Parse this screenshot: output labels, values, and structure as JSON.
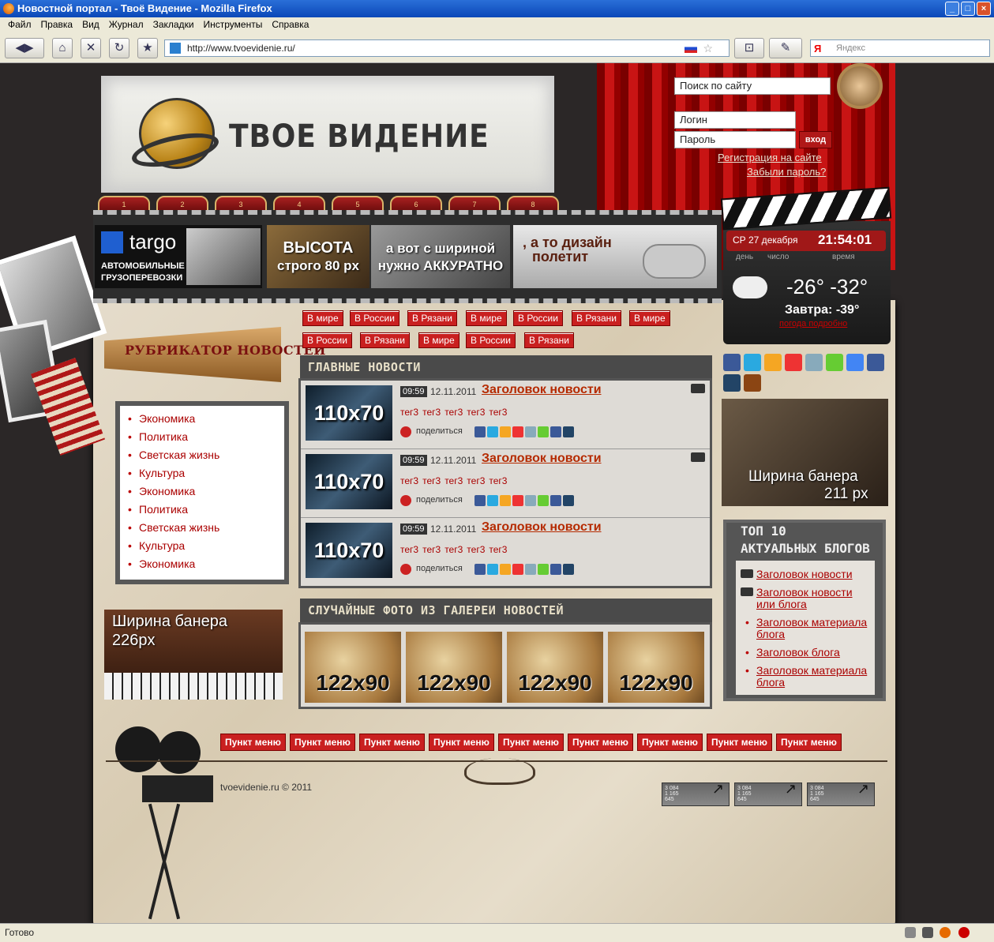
{
  "browser": {
    "title": "Новостной портал - Твоё Видение - Mozilla Firefox",
    "menu": [
      "Файл",
      "Правка",
      "Вид",
      "Журнал",
      "Закладки",
      "Инструменты",
      "Справка"
    ],
    "url": "http://www.tvoevidenie.ru/",
    "search_placeholder": "Яндекс",
    "search_engine_letter": "Я",
    "status": "Готово"
  },
  "header": {
    "logo_text": "ТВОЕ ВИДЕНИЕ",
    "site_search": "Поиск по сайту",
    "login": "Логин",
    "password": "Пароль",
    "login_button": "вход",
    "register": "Регистрация на сайте",
    "forgot": "Забыли пароль?",
    "tab_numbers": [
      "1",
      "2",
      "3",
      "4",
      "5",
      "6",
      "7",
      "8"
    ]
  },
  "banners": {
    "targo_name": "targo",
    "targo_sub1": "АВТОМОБИЛЬНЫЕ",
    "targo_sub2": "ГРУЗОПЕРЕВОЗКИ",
    "height_line1": "ВЫСОТА",
    "height_line2": "строго 80 px",
    "width_line1": "а вот с шириной",
    "width_line2": "нужно АККУРАТНО",
    "design_line1": ", а то дизайн",
    "design_line2": "полетит"
  },
  "rubricator": {
    "title": "РУБРИКАТОР НОВОСТЕЙ",
    "items": [
      "Экономика",
      "Политика",
      "Светская жизнь",
      "Культура",
      "Экономика",
      "Политика",
      "Светская жизнь",
      "Культура",
      "Экономика"
    ]
  },
  "left_banner": {
    "line1": "Ширина банера",
    "line2": "226px"
  },
  "categories_row1": [
    "В мире",
    "В России",
    "В Рязани",
    "В мире",
    "В России",
    "В Рязани",
    "В мире"
  ],
  "categories_row2": [
    "В России",
    "В Рязани",
    "В мире",
    "В России",
    "В Рязани"
  ],
  "main_news": {
    "title": "ГЛАВНЫЕ НОВОСТИ",
    "share_label": "поделиться",
    "items": [
      {
        "thumb": "110x70",
        "time": "09:59",
        "date": "12.11.2011",
        "headline": "Заголовок новости",
        "tags": [
          "тег3",
          "тег3",
          "тег3",
          "тег3",
          "тег3"
        ]
      },
      {
        "thumb": "110x70",
        "time": "09:59",
        "date": "12.11.2011",
        "headline": "Заголовок новости",
        "tags": [
          "тег3",
          "тег3",
          "тег3",
          "тег3",
          "тег3"
        ]
      },
      {
        "thumb": "110x70",
        "time": "09:59",
        "date": "12.11.2011",
        "headline": "Заголовок новости",
        "tags": [
          "тег3",
          "тег3",
          "тег3",
          "тег3",
          "тег3"
        ]
      }
    ]
  },
  "gallery": {
    "title": "СЛУЧАЙНЫЕ ФОТО ИЗ ГАЛЕРЕИ НОВОСТЕЙ",
    "items": [
      "122x90",
      "122x90",
      "122x90",
      "122x90"
    ]
  },
  "weather": {
    "date": "СР 27 декабря",
    "time": "21:54:01",
    "label_day": "день",
    "label_number": "число",
    "label_time": "время",
    "temp": "-26° -32°",
    "tomorrow": "Завтра: -39°",
    "more": "погода подробно"
  },
  "right_banner": {
    "line1": "Ширина банера",
    "line2": "211 px"
  },
  "top_blogs": {
    "title_line1": "ТОП 10",
    "title_line2": "АКТУАЛЬНЫХ БЛОГОВ",
    "items": [
      {
        "text": "Заголовок новости",
        "icon": "video-camera-icon"
      },
      {
        "text": "Заголовок новости или блога",
        "icon": "video-camera-icon"
      },
      {
        "text": "Заголовок материала блога",
        "icon": "bullet"
      },
      {
        "text": "Заголовок блога",
        "icon": "bullet"
      },
      {
        "text": "Заголовок материала блога",
        "icon": "bullet"
      }
    ]
  },
  "footer": {
    "menu": [
      "Пункт меню",
      "Пункт меню",
      "Пункт меню",
      "Пункт меню",
      "Пункт меню",
      "Пункт меню",
      "Пункт меню",
      "Пункт меню",
      "Пункт меню"
    ],
    "copyright": "tvoevidenie.ru © 2011",
    "counter_lines": [
      "3 084",
      "1 165",
      "645"
    ]
  },
  "colors": {
    "accent": "#c92020",
    "link": "#a00000",
    "headline": "#b52a00",
    "background": "#2b2727"
  }
}
